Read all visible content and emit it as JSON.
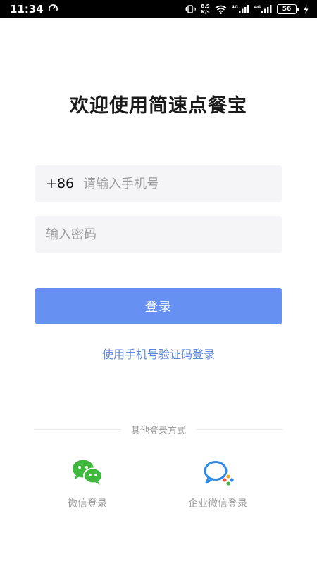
{
  "status_bar": {
    "time": "11:34",
    "net_speed_top": "8.9",
    "net_speed_bottom": "K/s",
    "net_type_1": "4G",
    "net_type_2": "4G",
    "battery": "56"
  },
  "login": {
    "title": "欢迎使用简速点餐宝",
    "country_code": "+86",
    "phone_placeholder": "请输入手机号",
    "password_placeholder": "输入密码",
    "login_button": "登录",
    "sms_login_link": "使用手机号验证码登录"
  },
  "other_login": {
    "divider_text": "其他登录方式",
    "wechat_label": "微信登录",
    "wework_label": "企业微信登录"
  },
  "colors": {
    "primary_button": "#6690f2",
    "link": "#5b86d6",
    "wechat_green": "#3fb93d",
    "wework_blue": "#2c8ae8"
  }
}
